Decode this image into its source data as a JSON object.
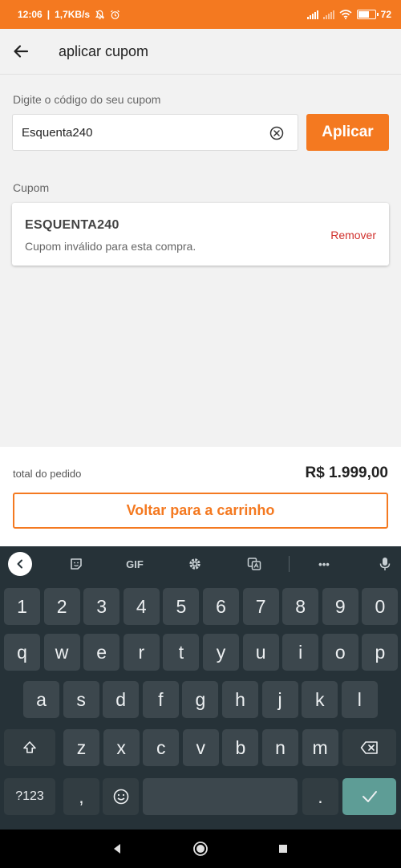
{
  "status_bar": {
    "time": "12:06",
    "speed": "1,7KB/s",
    "battery": "72",
    "battery_percent": 72
  },
  "header": {
    "title": "aplicar cupom",
    "back_icon": "arrow-left-icon"
  },
  "coupon_form": {
    "label": "Digite o código do seu cupom",
    "input_value": "Esquenta240",
    "clear_icon": "clear-circle-icon",
    "apply_label": "Aplicar"
  },
  "coupon_section": {
    "label": "Cupom",
    "code": "ESQUENTA240",
    "message": "Cupom inválido para esta compra.",
    "remove_label": "Remover"
  },
  "summary": {
    "total_label": "total do pedido",
    "total_value": "R$ 1.999,00",
    "back_button_label": "Voltar para a carrinho"
  },
  "keyboard": {
    "toolbar": {
      "gif_label": "GIF",
      "more_label": "•••"
    },
    "number_row": [
      "1",
      "2",
      "3",
      "4",
      "5",
      "6",
      "7",
      "8",
      "9",
      "0"
    ],
    "row1": [
      "q",
      "w",
      "e",
      "r",
      "t",
      "y",
      "u",
      "i",
      "o",
      "p"
    ],
    "row2": [
      "a",
      "s",
      "d",
      "f",
      "g",
      "h",
      "j",
      "k",
      "l"
    ],
    "row3": [
      "z",
      "x",
      "c",
      "v",
      "b",
      "n",
      "m"
    ],
    "symbols_label": "?123",
    "comma_label": ",",
    "period_label": "."
  },
  "colors": {
    "brand_orange": "#f47920",
    "error_red": "#d0302c",
    "keyboard_bg": "#263238",
    "key_bg": "#3c474d",
    "enter_key": "#5e9d96"
  }
}
